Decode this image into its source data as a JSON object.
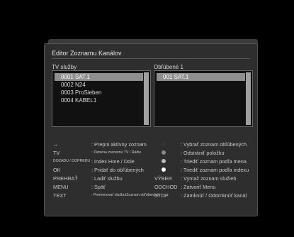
{
  "dialog": {
    "title": "Editor Zoznamu Kanálov",
    "left_header": "TV služby",
    "right_header": "Obľúbené 1",
    "tv_services": [
      "0001 SAT.1",
      "0002 N24",
      "0003 ProSieben",
      "0004 KABEL1"
    ],
    "favorites": [
      "001 SAT.1"
    ]
  },
  "help": [
    {
      "k1": "↔",
      "v1": ": Prepni aktívny zoznam",
      "dot": "#333333",
      "k2": "",
      "v2": ": Vybrať zoznam obľúbených"
    },
    {
      "k1": "TV",
      "v1": ": Zámena zoznamu TV / Rádio",
      "dot": "#8a8a8a",
      "k2": "",
      "v2": ": Odstrániť položku"
    },
    {
      "k1": "DOZADU / DOPREDU",
      "v1": ": Index Hore / Dole",
      "dot": "#bbbbbb",
      "k2": "",
      "v2": ": Triediť zoznam podľa mena"
    },
    {
      "k1": "OK",
      "v1": ": Pridať do obľúbených",
      "dot": "#ffffff",
      "k2": "",
      "v2": ": Triediť zoznam podľa indexu"
    },
    {
      "k1": "PREHRAŤ",
      "v1": ": Ladiť službu",
      "dot": "",
      "k2": "VÝBER",
      "v2": ": Vymaž zoznam služieb"
    },
    {
      "k1": "MENU",
      "v1": ": Späť",
      "dot": "",
      "k2": "ODCHOD",
      "v2": ": Zatvoriť Menu"
    },
    {
      "k1": "TEXT",
      "v1": ": Premenovať službu/Zoznam obľúbených",
      "dot": "",
      "k2": "STOP",
      "v2": ": Zamknúť / Odomknúť kanál"
    }
  ]
}
